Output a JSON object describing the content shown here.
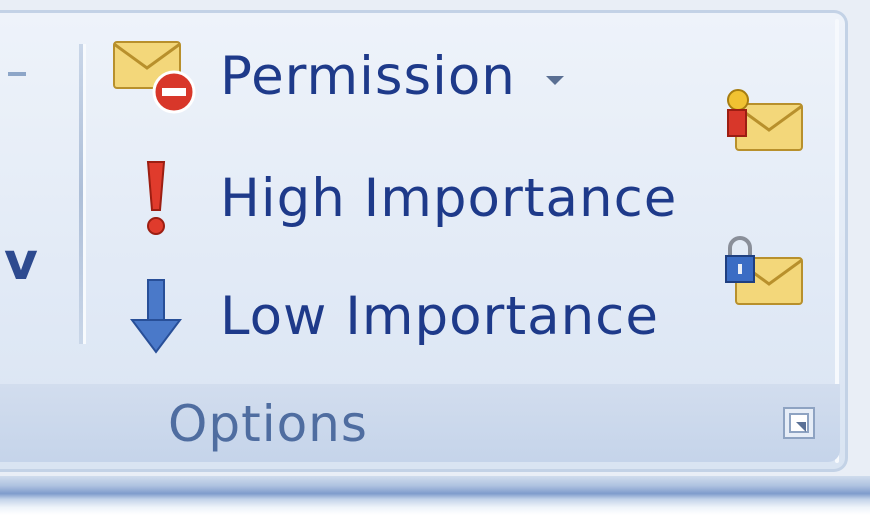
{
  "options_group": {
    "commands": {
      "permission": {
        "label": "Permission",
        "icon": "permission-envelope-icon"
      },
      "high_importance": {
        "label": "High Importance",
        "icon": "red-exclamation-icon"
      },
      "low_importance": {
        "label": "Low Importance",
        "icon": "blue-down-arrow-icon"
      }
    },
    "side_buttons": {
      "sign": {
        "icon": "digital-signature-envelope-icon"
      },
      "encrypt": {
        "icon": "encrypt-lock-envelope-icon"
      }
    },
    "label": "Options",
    "launcher_icon": "dialog-launcher-icon"
  },
  "left_group": {
    "partial_label": "v"
  },
  "colors": {
    "label_text": "#1e3a8a",
    "group_label": "#4f6da0",
    "panel_bg": "#e3eaf5"
  }
}
